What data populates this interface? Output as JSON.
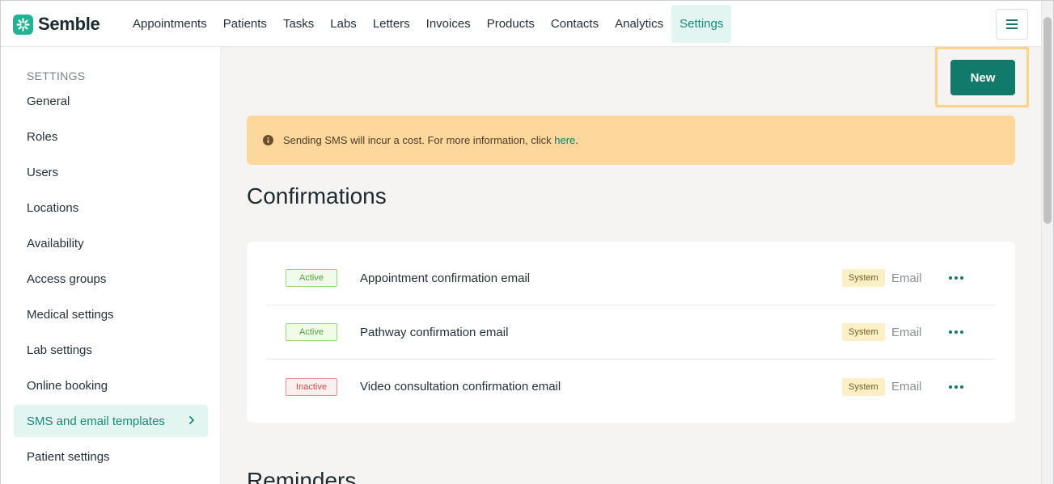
{
  "app": {
    "name": "Semble"
  },
  "nav": {
    "items": [
      {
        "label": "Appointments"
      },
      {
        "label": "Patients"
      },
      {
        "label": "Tasks"
      },
      {
        "label": "Labs"
      },
      {
        "label": "Letters"
      },
      {
        "label": "Invoices"
      },
      {
        "label": "Products"
      },
      {
        "label": "Contacts"
      },
      {
        "label": "Analytics"
      },
      {
        "label": "Settings"
      }
    ],
    "active": "Settings"
  },
  "sidebar": {
    "title": "SETTINGS",
    "items": [
      {
        "label": "General"
      },
      {
        "label": "Roles"
      },
      {
        "label": "Users"
      },
      {
        "label": "Locations"
      },
      {
        "label": "Availability"
      },
      {
        "label": "Access groups"
      },
      {
        "label": "Medical settings"
      },
      {
        "label": "Lab settings"
      },
      {
        "label": "Online booking"
      },
      {
        "label": "SMS and email templates"
      },
      {
        "label": "Patient settings"
      }
    ],
    "active": "SMS and email templates"
  },
  "main": {
    "new_button": "New",
    "banner": {
      "text": "Sending SMS will incur a cost. For more information, click ",
      "link": "here",
      "suffix": "."
    },
    "sections": [
      {
        "title": "Confirmations",
        "rows": [
          {
            "status": "Active",
            "title": "Appointment confirmation email",
            "tag": "System",
            "channel": "Email"
          },
          {
            "status": "Active",
            "title": "Pathway confirmation email",
            "tag": "System",
            "channel": "Email"
          },
          {
            "status": "Inactive",
            "title": "Video consultation confirmation email",
            "tag": "System",
            "channel": "Email"
          }
        ]
      },
      {
        "title": "Reminders",
        "rows": []
      }
    ]
  },
  "colors": {
    "brand": "#1fb594",
    "primary": "#117a6b",
    "banner": "#fed79c",
    "active_nav_bg": "#e2f5f1"
  }
}
